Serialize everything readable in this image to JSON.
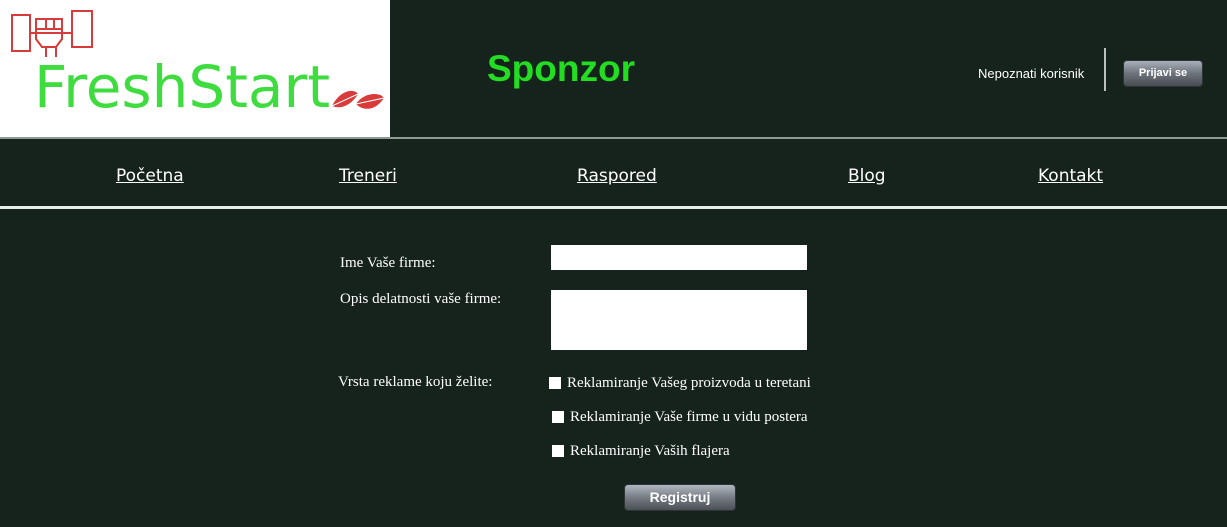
{
  "header": {
    "logo_text": "FreshStart",
    "page_title": "Sponzor",
    "user_label": "Nepoznati korisnik",
    "login_label": "Prijavi se"
  },
  "nav": {
    "items": [
      {
        "label": "Početna"
      },
      {
        "label": "Treneri"
      },
      {
        "label": "Raspored"
      },
      {
        "label": "Blog"
      },
      {
        "label": "Kontakt"
      }
    ]
  },
  "form": {
    "company_name_label": "Ime Vaše firme:",
    "company_name_value": "",
    "description_label": "Opis delatnosti vaše firme:",
    "description_value": "",
    "ad_type_label": "Vrsta reklame koju želite:",
    "options": [
      {
        "label": "Reklamiranje Vašeg proizvoda u teretani",
        "checked": false
      },
      {
        "label": "Reklamiranje Vaše firme u vidu postera",
        "checked": false
      },
      {
        "label": "Reklamiranje Vaših flajera",
        "checked": false
      }
    ],
    "submit_label": "Registruj"
  },
  "colors": {
    "background": "#16221c",
    "title_green": "#22dd22",
    "logo_green": "#3fdc3f",
    "logo_red": "#d93a3a"
  },
  "icons": {
    "logo_emblem": "raised-fist-icon",
    "logo_leaf": "leaf-icon"
  }
}
